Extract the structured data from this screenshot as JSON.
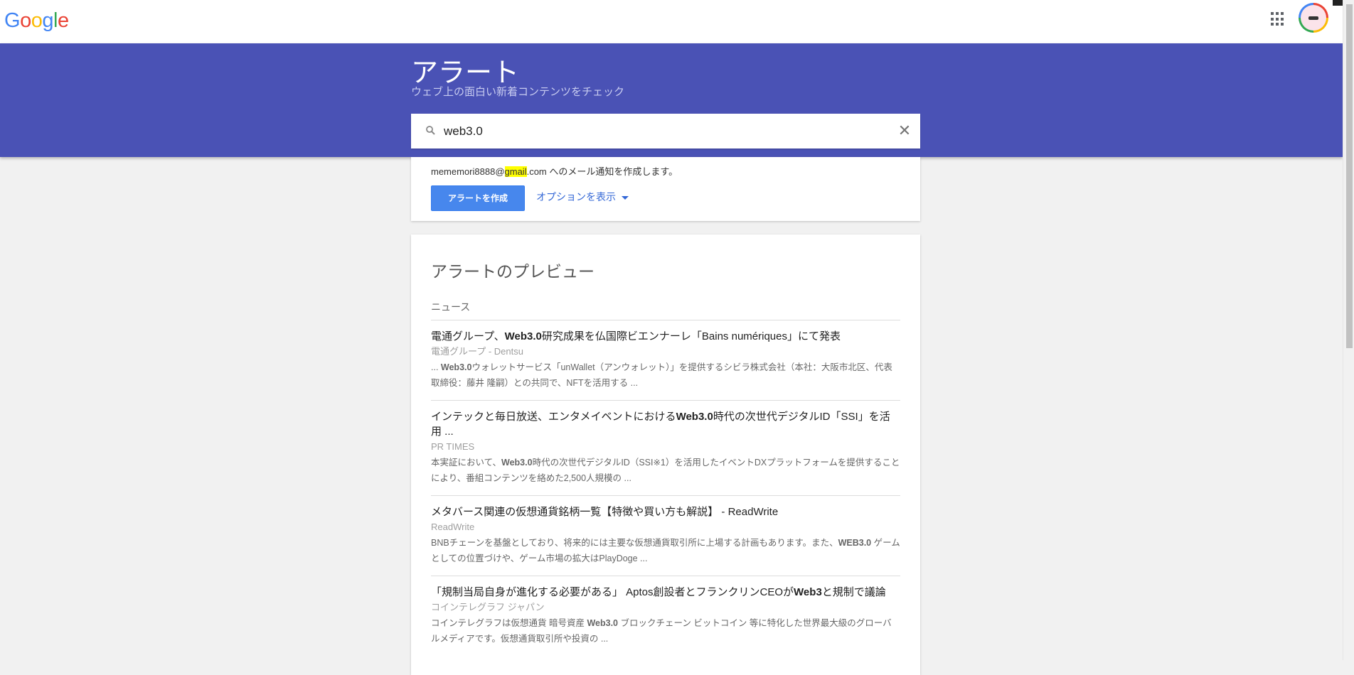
{
  "header": {
    "logo_letters": [
      {
        "ch": "G",
        "color": "#4285f4"
      },
      {
        "ch": "o",
        "color": "#ea4335"
      },
      {
        "ch": "o",
        "color": "#fbbc05"
      },
      {
        "ch": "g",
        "color": "#4285f4"
      },
      {
        "ch": "l",
        "color": "#34a853"
      },
      {
        "ch": "e",
        "color": "#ea4335"
      }
    ],
    "apps_icon": "apps-grid-icon",
    "avatar_icon": "account-avatar"
  },
  "band": {
    "title": "アラート",
    "subtitle": "ウェブ上の面白い新着コンテンツをチェック",
    "color": "#4a52b5"
  },
  "search": {
    "value": "web3.0",
    "placeholder": "",
    "search_icon": "search-icon",
    "clear_icon": "close-icon",
    "clear_glyph": "✕"
  },
  "create": {
    "email_prefix": "mememori8888@",
    "email_highlight": "gmail",
    "email_suffix": ".com へのメール通知を作成します。",
    "create_button": "アラートを作成",
    "options_link": "オプションを表示"
  },
  "preview": {
    "title": "アラートのプレビュー",
    "section_label": "ニュース",
    "results": [
      {
        "title_html": "電通グループ、<b>Web3.0</b>研究成果を仏国際ビエンナーレ「Bains numériques」にて発表",
        "source": "電通グループ - Dentsu",
        "snippet_html": "... <b>Web3.0</b>ウォレットサービス「unWallet（アンウォレット）」を提供するシビラ株式会社（本社：大阪市北区、代表取締役：藤井 隆嗣）との共同で、NFTを活用する ..."
      },
      {
        "title_html": "インテックと毎日放送、エンタメイベントにおける<b>Web3.0</b>時代の次世代デジタルID「SSI」を活用 ...",
        "source": "PR TIMES",
        "snippet_html": "本実証において、<b>Web3.0</b>時代の次世代デジタルID（SSI※1）を活用したイベントDXプラットフォームを提供することにより、番組コンテンツを絡めた2,500人規模の ..."
      },
      {
        "title_html": "メタバース関連の仮想通貨銘柄一覧【特徴や買い方も解説】 - ReadWrite",
        "source": "ReadWrite",
        "snippet_html": "BNBチェーンを基盤としており、将来的には主要な仮想通貨取引所に上場する計画もあります。また、<b>WEB3.0</b> ゲームとしての位置づけや、ゲーム市場の拡大はPlayDoge ..."
      },
      {
        "title_html": "「規制当局自身が進化する必要がある」 Aptos創設者とフランクリンCEOが<b>Web3</b>と規制で議論",
        "source": "コインテレグラフ ジャパン",
        "snippet_html": "コインテレグラフは仮想通貨 暗号資産 <b>Web3.0</b> ブロックチェーン ビットコイン 等に特化した世界最大級のグローバルメディアです。仮想通貨取引所や投資の ..."
      }
    ]
  }
}
